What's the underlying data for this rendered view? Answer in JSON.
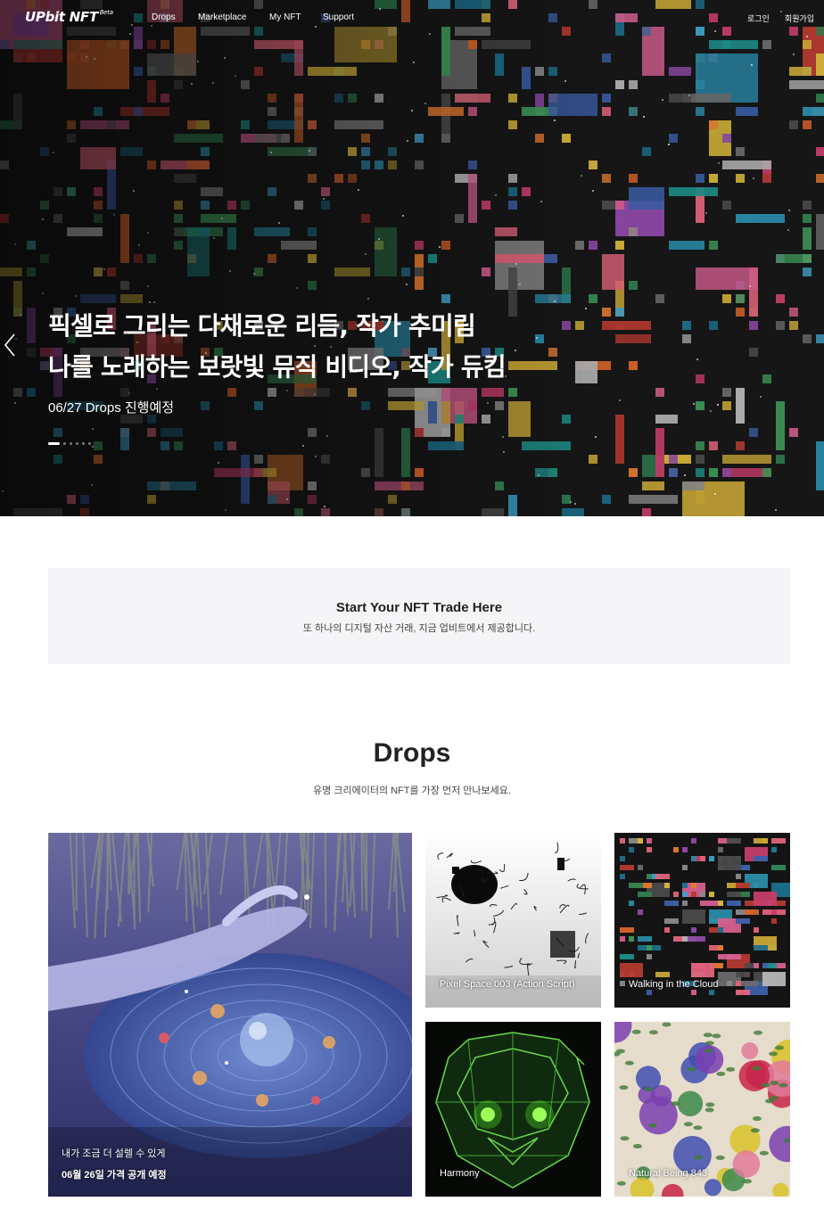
{
  "brand": {
    "logo": "UPbit NFT",
    "beta": "Beta"
  },
  "nav": {
    "items": [
      "Drops",
      "Marketplace",
      "My NFT",
      "Support"
    ],
    "login": "로그인",
    "signup": "회원가입"
  },
  "hero": {
    "title_line1": "픽셀로 그리는 다채로운 리듬, 작가 추미림",
    "title_line2": "나를 노래하는 보랏빛 뮤직 비디오, 작가 듀킴",
    "subtitle": "06/27 Drops 진행예정",
    "slide_count": 6,
    "active_slide": 1
  },
  "info": {
    "title": "Start Your NFT Trade Here",
    "subtitle": "또 하나의 디지털 자산 거래, 지금 업비트에서 제공합니다."
  },
  "drops": {
    "title": "Drops",
    "subtitle": "유명 크리에이터의 NFT를 가장 먼저 만나보세요.",
    "featured": {
      "line1": "내가 조금 더 설렐 수 있게",
      "line2": "06월 26일 가격 공개 예정"
    },
    "cards": [
      {
        "label": "Pixel Space 003 (Action Script)"
      },
      {
        "label": "Walking in the Cloud"
      },
      {
        "label": "Harmony"
      },
      {
        "label": "Natural Being 843"
      }
    ]
  }
}
